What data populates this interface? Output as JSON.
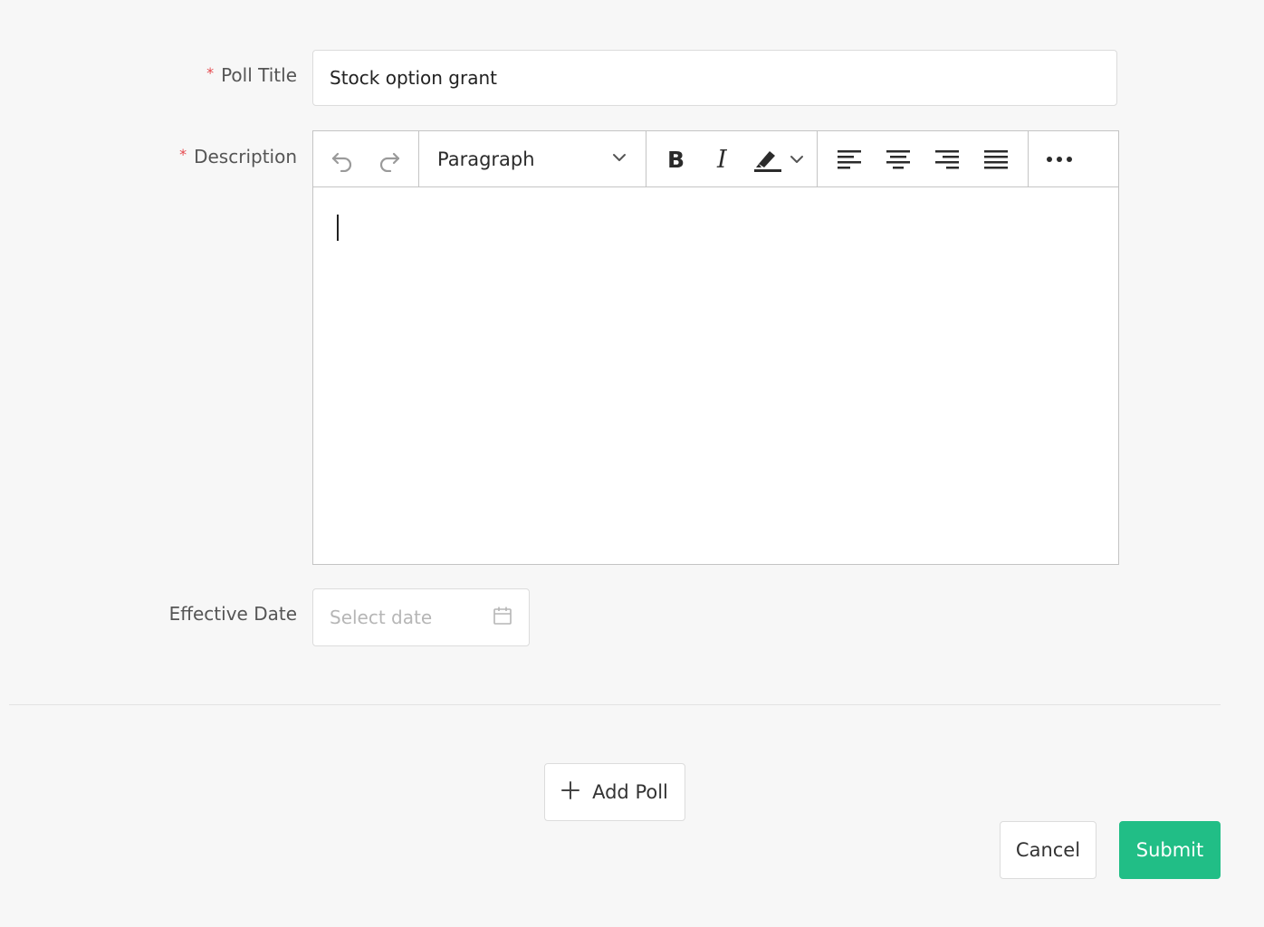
{
  "form": {
    "poll_title": {
      "label": "Poll Title",
      "required_marker": "*",
      "value": "Stock option grant"
    },
    "description": {
      "label": "Description",
      "required_marker": "*",
      "toolbar": {
        "undo_icon": "undo-icon",
        "redo_icon": "redo-icon",
        "block_format": "Paragraph",
        "bold_icon": "bold-icon",
        "italic_icon": "italic-icon",
        "highlight_icon": "highlight-icon",
        "align_left_icon": "align-left-icon",
        "align_center_icon": "align-center-icon",
        "align_right_icon": "align-right-icon",
        "justify_icon": "justify-icon",
        "more_icon": "more-icon"
      },
      "content": ""
    },
    "effective_date": {
      "label": "Effective Date",
      "placeholder": "Select date",
      "icon": "calendar-icon"
    }
  },
  "actions": {
    "add_poll": "Add Poll",
    "cancel": "Cancel",
    "submit": "Submit"
  },
  "colors": {
    "primary": "#21be86",
    "required": "#e5484d",
    "background": "#f7f7f7"
  }
}
